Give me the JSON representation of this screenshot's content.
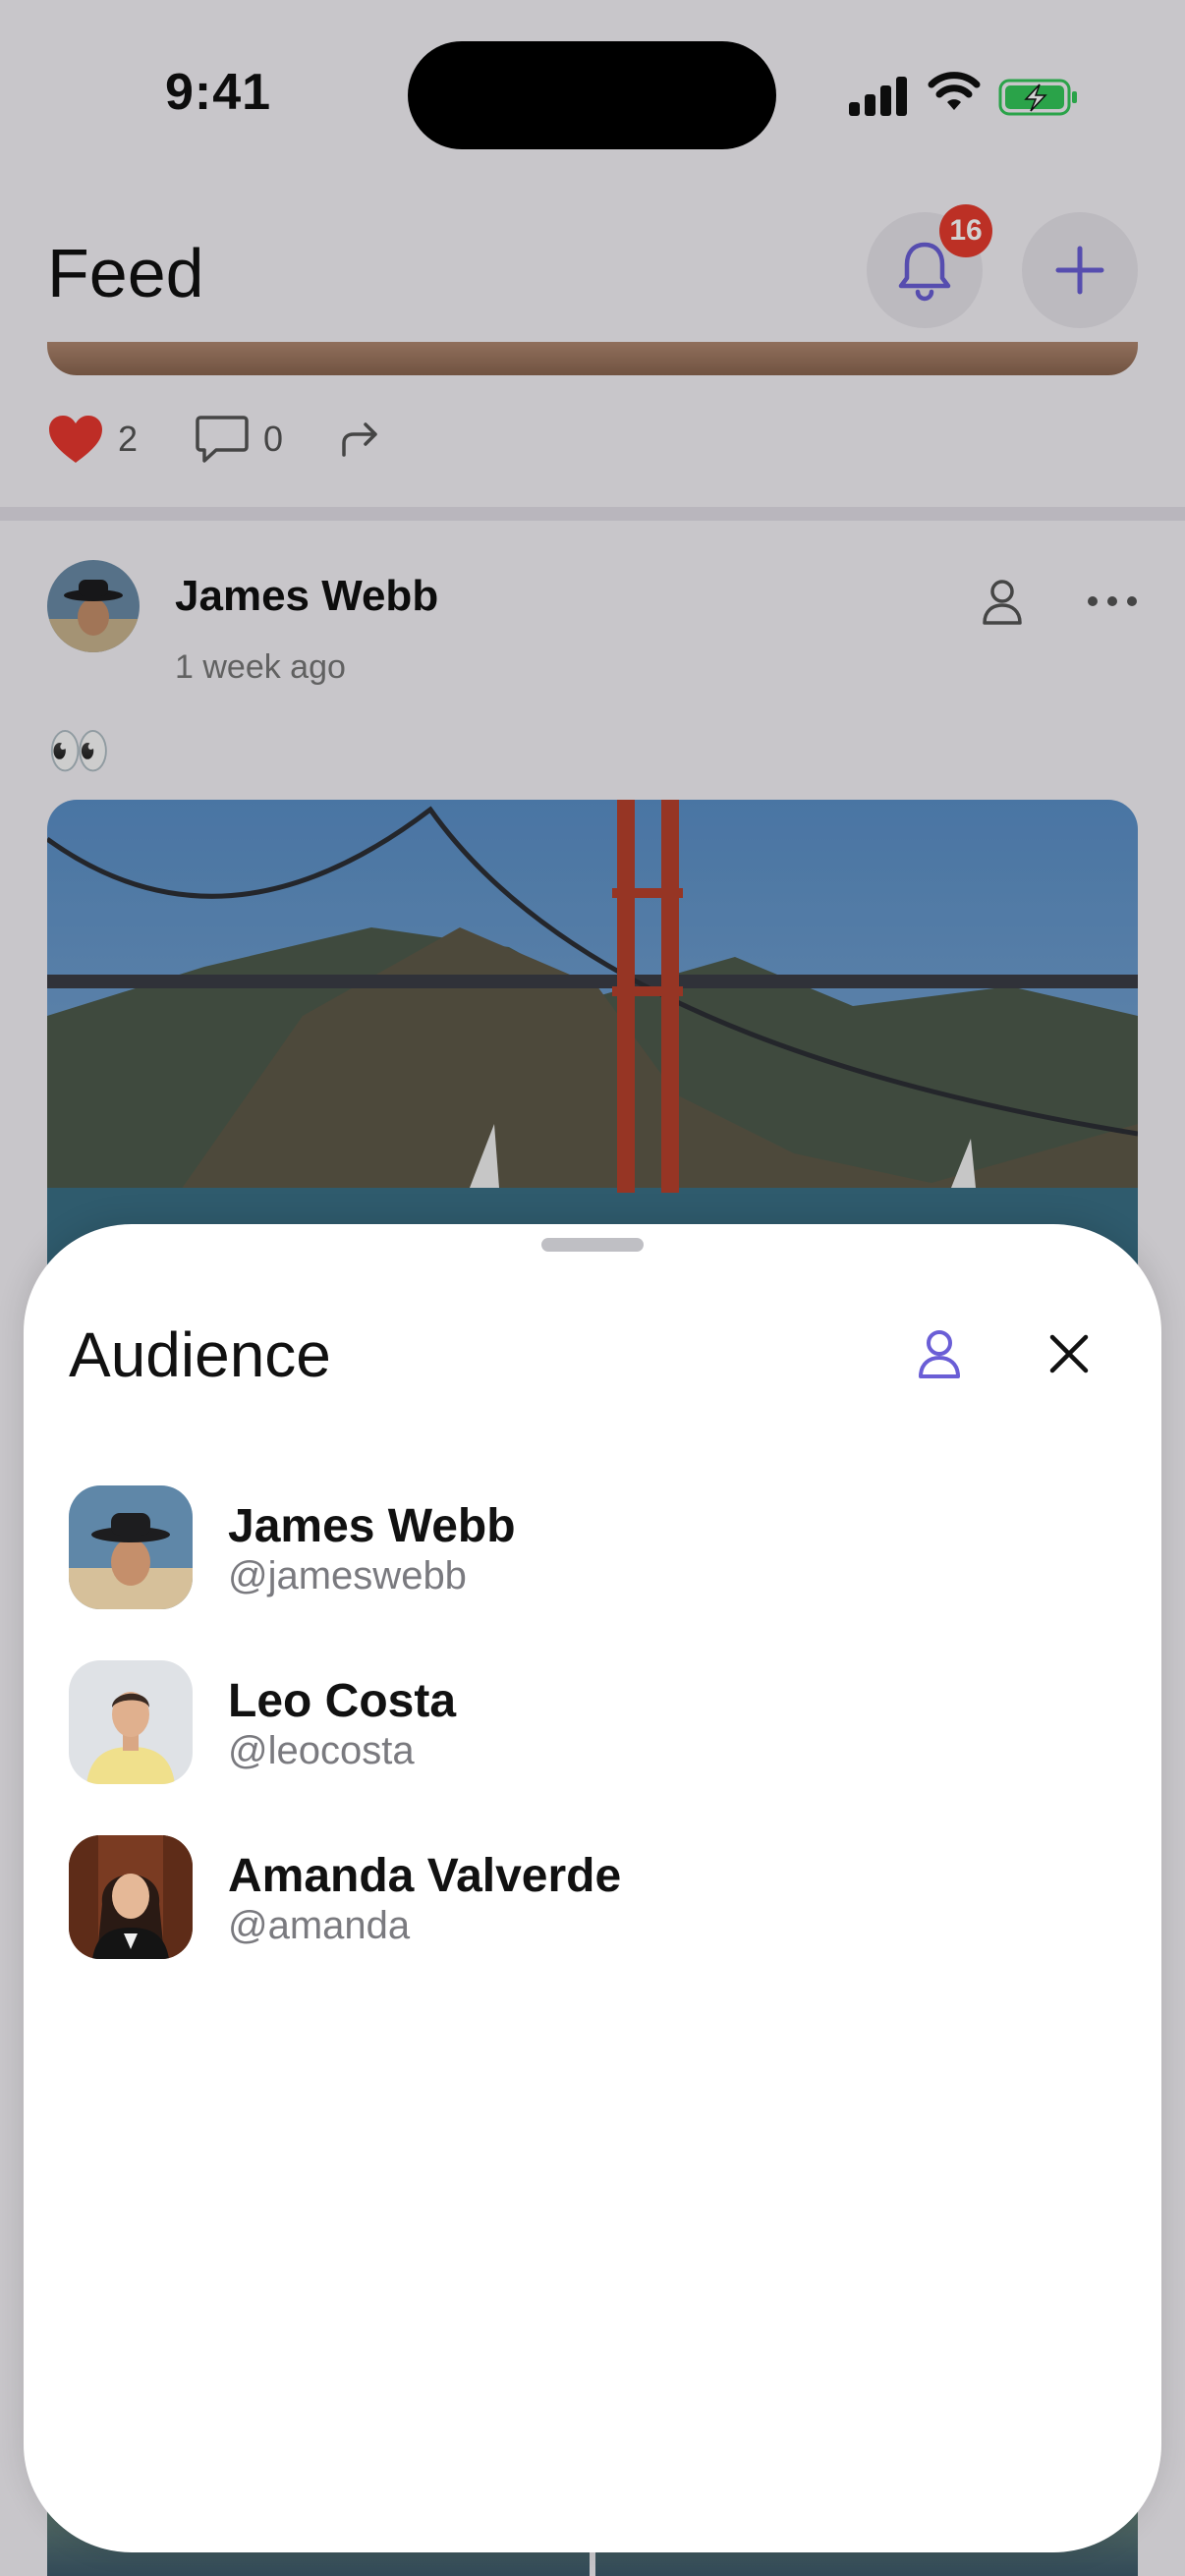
{
  "status_bar": {
    "time": "9:41"
  },
  "feed": {
    "title": "Feed",
    "notification_count": "16",
    "previous_post": {
      "likes": "2",
      "comments": "0"
    },
    "post": {
      "author": "James Webb",
      "timestamp": "1 week ago",
      "text": "👀"
    }
  },
  "audience_sheet": {
    "title": "Audience",
    "members": [
      {
        "name": "James Webb",
        "handle": "@jameswebb"
      },
      {
        "name": "Leo Costa",
        "handle": "@leocosta"
      },
      {
        "name": "Amanda Valverde",
        "handle": "@amanda"
      }
    ]
  },
  "colors": {
    "accent": "#6a5ed6",
    "badge": "#e63b2e",
    "heart": "#e8382f",
    "battery": "#34c759"
  }
}
